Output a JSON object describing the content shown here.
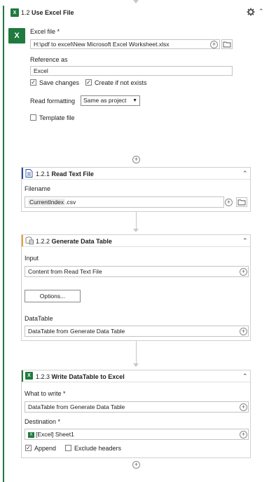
{
  "main_action": {
    "step": "1.2",
    "title": "Use Excel File",
    "excel_file_label": "Excel file *",
    "excel_file_value": "H:\\pdf to excel\\New Microsoft Excel Worksheet.xlsx",
    "reference_label": "Reference as",
    "reference_value": "Excel",
    "save_changes_label": "Save changes",
    "save_changes_checked": true,
    "create_if_not_exists_label": "Create if not exists",
    "create_if_not_exists_checked": true,
    "read_formatting_label": "Read formatting",
    "read_formatting_value": "Same as project",
    "template_file_label": "Template file",
    "template_file_checked": false
  },
  "read_text_file": {
    "step": "1.2.1",
    "title": "Read Text File",
    "filename_label": "Filename",
    "filename_variable": "CurrentIndex",
    "filename_suffix": ".csv"
  },
  "generate_data_table": {
    "step": "1.2.2",
    "title": "Generate Data Table",
    "input_label": "Input",
    "input_value": "Content from Read Text File",
    "options_button": "Options...",
    "datatable_label": "DataTable",
    "datatable_value": "DataTable from Generate Data Table"
  },
  "write_datatable": {
    "step": "1.2.3",
    "title": "Write DataTable to Excel",
    "what_to_write_label": "What to write *",
    "what_to_write_value": "DataTable from Generate Data Table",
    "destination_label": "Destination *",
    "destination_value": "[Excel] Sheet1",
    "append_label": "Append",
    "append_checked": true,
    "exclude_headers_label": "Exclude headers",
    "exclude_headers_checked": false
  },
  "icons": {
    "settings": "gear-icon",
    "collapse": "chevron-up-icon",
    "add": "plus-circle-icon",
    "browse": "folder-icon",
    "excel": "excel-icon"
  },
  "colors": {
    "excel_green": "#1f7a3d",
    "read_text_accent": "#2b4fa0",
    "generate_table_accent": "#e8a33a"
  }
}
